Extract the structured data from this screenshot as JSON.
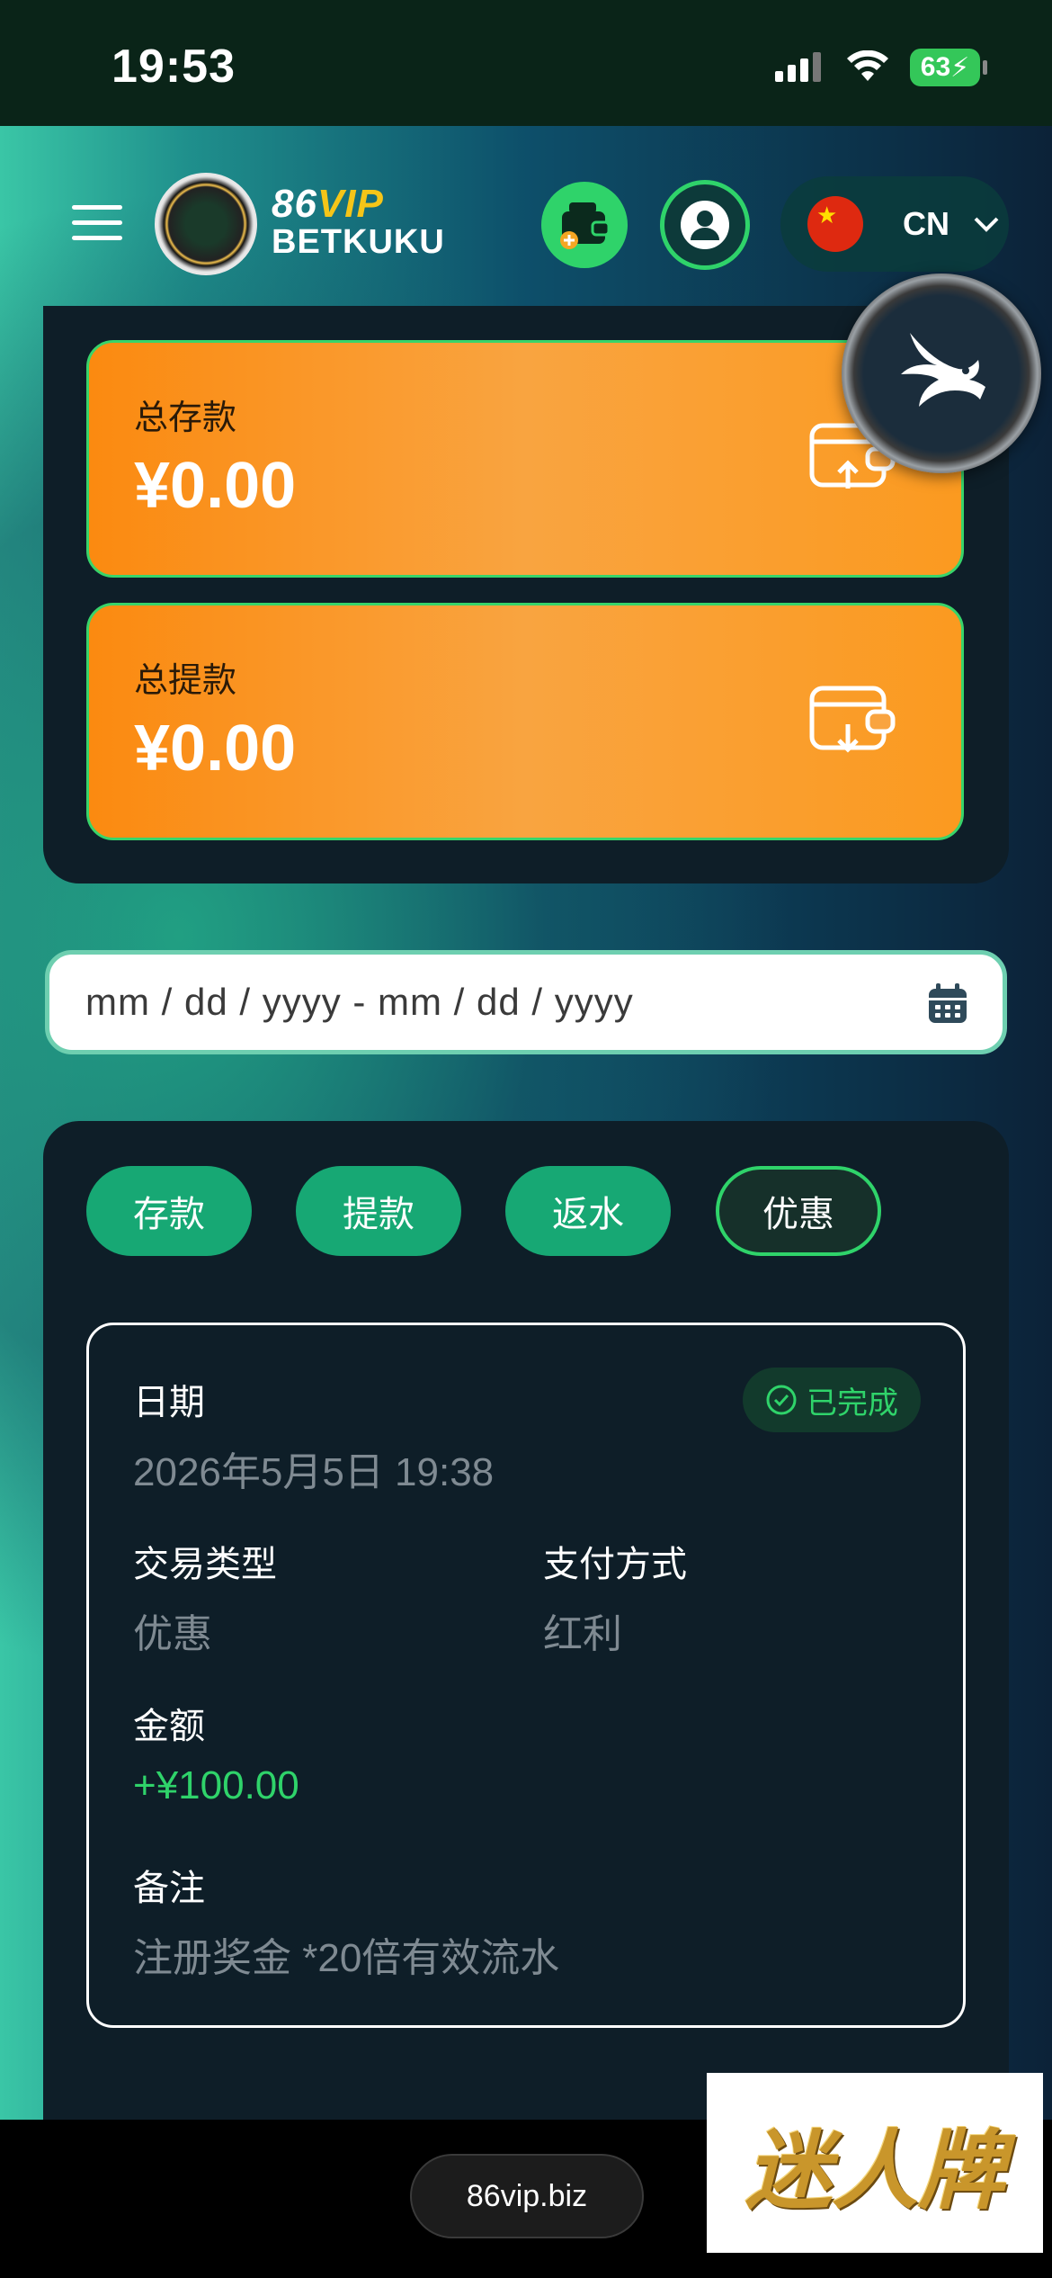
{
  "status_bar": {
    "time": "19:53",
    "battery": "63"
  },
  "header": {
    "logo_line1_a": "86",
    "logo_line1_b": "VIP",
    "logo_line2": "BETKUKU",
    "language_code": "CN"
  },
  "stats": {
    "total_deposit_label": "总存款",
    "total_deposit_value": "¥0.00",
    "total_withdraw_label": "总提款",
    "total_withdraw_value": "¥0.00"
  },
  "date_range": {
    "placeholder": "mm / dd / yyyy  -  mm / dd / yyyy"
  },
  "tabs": [
    {
      "label": "存款"
    },
    {
      "label": "提款"
    },
    {
      "label": "返水"
    },
    {
      "label": "优惠",
      "active": true
    }
  ],
  "record": {
    "status": "已完成",
    "date_label": "日期",
    "date_value": "2026年5月5日 19:38",
    "type_label": "交易类型",
    "type_value": "优惠",
    "payment_label": "支付方式",
    "payment_value": "红利",
    "amount_label": "金额",
    "amount_value": "+¥100.00",
    "note_label": "备注",
    "note_value": "注册奖金 *20倍有效流水"
  },
  "footer": {
    "url": "86vip.biz",
    "watermark": "迷人牌"
  },
  "colors": {
    "accent_green": "#2fd36a",
    "tab_green": "#17a874",
    "card_orange": "#fb8a10",
    "panel_bg": "#0e1e28"
  }
}
